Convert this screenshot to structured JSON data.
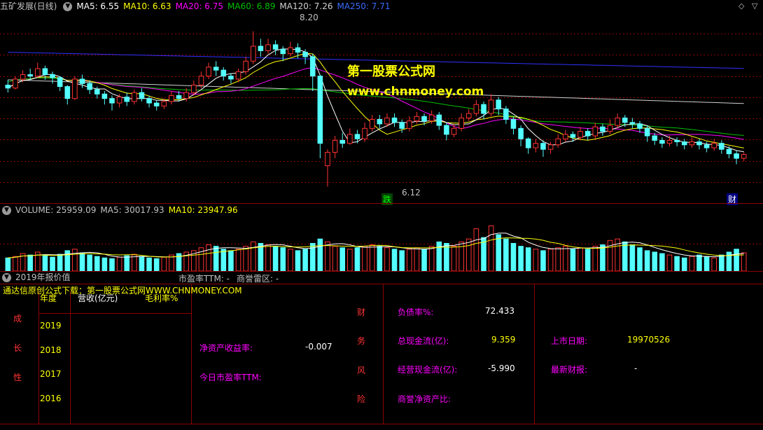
{
  "price_header": {
    "title": "五矿发展(日线)",
    "ma5": "MA5: 6.55",
    "ma10": "MA10: 6.63",
    "ma20": "MA20: 6.75",
    "ma60": "MA60: 6.89",
    "ma120": "MA120: 7.26",
    "ma250": "MA250: 7.71"
  },
  "price_annotations": {
    "high": "8.20",
    "low": "6.12",
    "tag_die": "跌",
    "tag_cai": "财"
  },
  "watermark": {
    "line1": "第一股票公式网",
    "line2": "www.chnmoney.com"
  },
  "volume_header": {
    "title": "VOLUME: 25959.09",
    "ma5": "MA5: 30017.93",
    "ma10": "MA10: 23947.96"
  },
  "report_header": {
    "title": "2019年报价值",
    "pe_ttm": "市盈率TTM: -",
    "goodwill": "商誉雷区: -"
  },
  "panel": {
    "banner": "通达信原创公式下载：第一股票公式网WWW.CHNMONEY.COM",
    "growth_label": [
      "成",
      "长",
      "性"
    ],
    "col_year": "年度",
    "col_revenue": "营收(亿元)",
    "col_margin": "毛利率%",
    "years": [
      "2019",
      "2018",
      "2017",
      "2016"
    ],
    "roe_label": "净资产收益率:",
    "roe_value": "-0.007",
    "pe_today_label": "今日市盈率TTM:",
    "risk_label": [
      "财",
      "务",
      "风",
      "险"
    ],
    "debt_ratio_label": "负债率%:",
    "debt_ratio_value": "72.433",
    "cashflow_label": "总现金流(亿):",
    "cashflow_value": "9.359",
    "op_cashflow_label": "经营现金流(亿):",
    "op_cashflow_value": "-5.990",
    "goodwill_ratio_label": "商誉净资产比:",
    "listing_label": "上市日期:",
    "listing_value": "19970526",
    "latest_report_label": "最新财报:",
    "latest_report_value": "-"
  },
  "colors": {
    "up": "#ff3232",
    "down": "#54ffff",
    "ma5": "#ffffff",
    "ma10": "#ffff00",
    "ma20": "#ff00ff",
    "ma60": "#00c000",
    "ma120": "#d0d0d0",
    "ma250": "#3030ff",
    "grid": "#8b0000"
  },
  "chart_data": {
    "type": "candlestick",
    "price_ylim": [
      5.9,
      8.45
    ],
    "candles": [
      [
        7.48,
        7.44,
        7.55,
        7.38
      ],
      [
        7.44,
        7.56,
        7.6,
        7.42
      ],
      [
        7.56,
        7.62,
        7.68,
        7.52
      ],
      [
        7.62,
        7.6,
        7.7,
        7.54
      ],
      [
        7.6,
        7.7,
        7.78,
        7.58
      ],
      [
        7.7,
        7.62,
        7.74,
        7.55
      ],
      [
        7.62,
        7.58,
        7.66,
        7.5
      ],
      [
        7.58,
        7.46,
        7.6,
        7.4
      ],
      [
        7.46,
        7.3,
        7.48,
        7.22
      ],
      [
        7.3,
        7.56,
        7.6,
        7.28
      ],
      [
        7.56,
        7.5,
        7.62,
        7.44
      ],
      [
        7.5,
        7.42,
        7.54,
        7.36
      ],
      [
        7.42,
        7.36,
        7.46,
        7.3
      ],
      [
        7.36,
        7.3,
        7.4,
        7.22
      ],
      [
        7.3,
        7.24,
        7.34,
        7.14
      ],
      [
        7.24,
        7.32,
        7.36,
        7.18
      ],
      [
        7.32,
        7.26,
        7.38,
        7.2
      ],
      [
        7.26,
        7.38,
        7.42,
        7.22
      ],
      [
        7.38,
        7.3,
        7.44,
        7.26
      ],
      [
        7.3,
        7.24,
        7.34,
        7.18
      ],
      [
        7.24,
        7.2,
        7.28,
        7.14
      ],
      [
        7.2,
        7.26,
        7.3,
        7.16
      ],
      [
        7.26,
        7.34,
        7.4,
        7.22
      ],
      [
        7.34,
        7.3,
        7.4,
        7.26
      ],
      [
        7.3,
        7.38,
        7.44,
        7.26
      ],
      [
        7.38,
        7.48,
        7.54,
        7.34
      ],
      [
        7.48,
        7.6,
        7.66,
        7.44
      ],
      [
        7.6,
        7.72,
        7.78,
        7.56
      ],
      [
        7.72,
        7.68,
        7.8,
        7.6
      ],
      [
        7.68,
        7.6,
        7.72,
        7.54
      ],
      [
        7.6,
        7.56,
        7.64,
        7.5
      ],
      [
        7.56,
        7.66,
        7.7,
        7.52
      ],
      [
        7.66,
        7.8,
        7.86,
        7.62
      ],
      [
        7.8,
        8.0,
        8.2,
        7.76
      ],
      [
        8.0,
        7.94,
        8.1,
        7.86
      ],
      [
        7.94,
        8.02,
        8.1,
        7.9
      ],
      [
        8.02,
        7.96,
        8.08,
        7.88
      ],
      [
        7.96,
        7.9,
        8.0,
        7.8
      ],
      [
        7.9,
        7.98,
        8.06,
        7.86
      ],
      [
        7.98,
        7.92,
        8.04,
        7.84
      ],
      [
        7.92,
        7.86,
        7.96,
        7.76
      ],
      [
        7.86,
        7.6,
        7.9,
        7.4
      ],
      [
        7.6,
        6.7,
        7.62,
        6.5
      ],
      [
        6.4,
        6.58,
        6.62,
        6.12
      ],
      [
        6.58,
        6.74,
        6.8,
        6.5
      ],
      [
        6.74,
        6.7,
        6.84,
        6.64
      ],
      [
        6.7,
        6.82,
        6.9,
        6.68
      ],
      [
        6.82,
        6.76,
        6.88,
        6.7
      ],
      [
        6.76,
        6.9,
        6.98,
        6.72
      ],
      [
        6.9,
        7.02,
        7.08,
        6.86
      ],
      [
        7.02,
        6.96,
        7.08,
        6.9
      ],
      [
        6.96,
        7.04,
        7.1,
        6.92
      ],
      [
        7.04,
        6.98,
        7.1,
        6.92
      ],
      [
        6.98,
        6.9,
        7.02,
        6.84
      ],
      [
        6.9,
        7.0,
        7.06,
        6.86
      ],
      [
        7.0,
        7.06,
        7.12,
        6.96
      ],
      [
        7.06,
        7.0,
        7.1,
        6.94
      ],
      [
        7.0,
        7.08,
        7.14,
        6.96
      ],
      [
        7.08,
        6.94,
        7.12,
        6.88
      ],
      [
        6.94,
        6.82,
        6.98,
        6.74
      ],
      [
        6.82,
        6.9,
        6.96,
        6.78
      ],
      [
        6.9,
        7.04,
        7.1,
        6.86
      ],
      [
        7.04,
        7.1,
        7.16,
        7.0
      ],
      [
        7.1,
        7.22,
        7.28,
        7.06
      ],
      [
        7.22,
        7.1,
        7.26,
        7.02
      ],
      [
        7.1,
        7.28,
        7.36,
        7.06
      ],
      [
        7.28,
        7.16,
        7.32,
        7.08
      ],
      [
        7.16,
        7.02,
        7.2,
        6.96
      ],
      [
        7.02,
        6.9,
        7.06,
        6.82
      ],
      [
        6.9,
        6.76,
        6.94,
        6.66
      ],
      [
        6.76,
        6.64,
        6.78,
        6.56
      ],
      [
        6.64,
        6.7,
        6.76,
        6.58
      ],
      [
        6.7,
        6.62,
        6.74,
        6.52
      ],
      [
        6.62,
        6.68,
        6.72,
        6.56
      ],
      [
        6.68,
        6.76,
        6.82,
        6.64
      ],
      [
        6.76,
        6.82,
        6.88,
        6.72
      ],
      [
        6.82,
        6.78,
        6.86,
        6.72
      ],
      [
        6.78,
        6.86,
        6.92,
        6.74
      ],
      [
        6.86,
        6.8,
        6.9,
        6.74
      ],
      [
        6.8,
        6.92,
        6.98,
        6.76
      ],
      [
        6.92,
        6.86,
        6.96,
        6.8
      ],
      [
        6.86,
        6.94,
        7.02,
        6.82
      ],
      [
        6.94,
        7.04,
        7.1,
        6.9
      ],
      [
        7.04,
        6.98,
        7.08,
        6.92
      ],
      [
        6.98,
        6.96,
        7.04,
        6.9
      ],
      [
        6.96,
        6.9,
        7.0,
        6.84
      ],
      [
        6.9,
        6.8,
        6.94,
        6.72
      ],
      [
        6.8,
        6.74,
        6.84,
        6.68
      ],
      [
        6.74,
        6.7,
        6.78,
        6.64
      ],
      [
        6.7,
        6.74,
        6.8,
        6.66
      ],
      [
        6.74,
        6.72,
        6.78,
        6.66
      ],
      [
        6.72,
        6.68,
        6.76,
        6.62
      ],
      [
        6.68,
        6.72,
        6.78,
        6.64
      ],
      [
        6.72,
        6.68,
        6.76,
        6.62
      ],
      [
        6.68,
        6.64,
        6.72,
        6.58
      ],
      [
        6.64,
        6.7,
        6.76,
        6.6
      ],
      [
        6.7,
        6.62,
        6.74,
        6.56
      ],
      [
        6.62,
        6.56,
        6.66,
        6.5
      ],
      [
        6.56,
        6.5,
        6.6,
        6.42
      ],
      [
        6.5,
        6.55,
        6.58,
        6.46
      ]
    ],
    "volume": [
      18,
      20,
      24,
      22,
      26,
      21,
      19,
      23,
      28,
      30,
      25,
      22,
      20,
      18,
      17,
      19,
      21,
      23,
      20,
      18,
      17,
      19,
      22,
      24,
      26,
      28,
      32,
      36,
      34,
      30,
      28,
      30,
      34,
      40,
      38,
      36,
      34,
      32,
      30,
      28,
      30,
      38,
      44,
      40,
      34,
      32,
      30,
      32,
      34,
      36,
      34,
      32,
      30,
      28,
      30,
      32,
      30,
      34,
      40,
      38,
      34,
      40,
      44,
      58,
      46,
      62,
      50,
      44,
      38,
      34,
      32,
      30,
      28,
      30,
      32,
      34,
      30,
      32,
      30,
      34,
      36,
      42,
      44,
      40,
      36,
      32,
      28,
      26,
      24,
      22,
      20,
      18,
      20,
      22,
      20,
      18,
      22,
      26,
      30,
      25
    ],
    "volume_ylim": [
      0,
      75
    ]
  }
}
